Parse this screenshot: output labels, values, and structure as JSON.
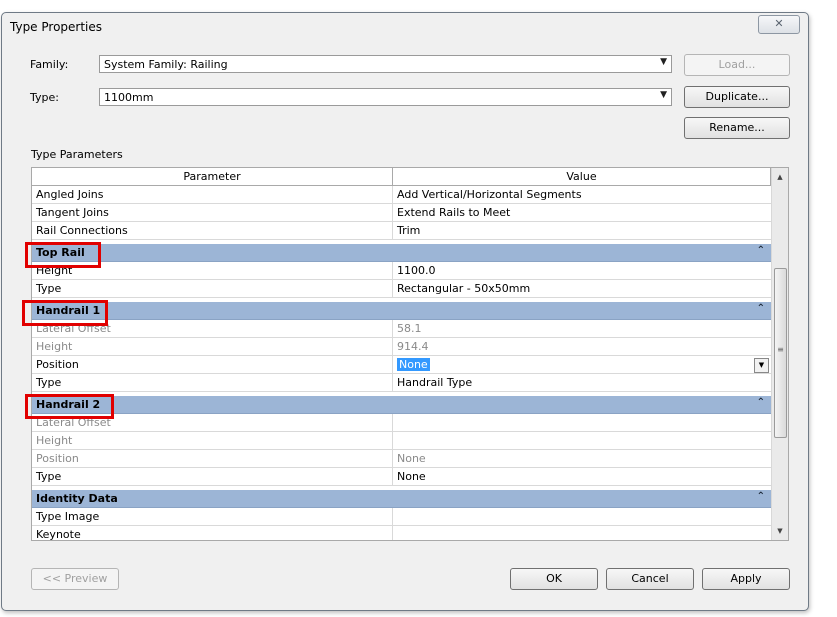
{
  "window": {
    "title": "Type Properties",
    "close_glyph": "✕"
  },
  "family": {
    "label": "Family:",
    "value": "System Family: Railing"
  },
  "type": {
    "label": "Type:",
    "value": "1100mm"
  },
  "buttons": {
    "load": "Load...",
    "duplicate": "Duplicate...",
    "rename": "Rename...",
    "preview": "<< Preview",
    "ok": "OK",
    "cancel": "Cancel",
    "apply": "Apply"
  },
  "type_parameters_label": "Type Parameters",
  "grid": {
    "headers": [
      "Parameter",
      "Value"
    ],
    "rows_top": [
      {
        "param": "Angled Joins",
        "value": "Add Vertical/Horizontal Segments"
      },
      {
        "param": "Tangent Joins",
        "value": "Extend Rails to Meet"
      },
      {
        "param": "Rail Connections",
        "value": "Trim"
      }
    ],
    "top_rail": {
      "label": "Top Rail",
      "rows": [
        {
          "param": "Height",
          "value": "1100.0"
        },
        {
          "param": "Type",
          "value": "Rectangular - 50x50mm"
        }
      ]
    },
    "handrail1": {
      "label": "Handrail 1",
      "rows": [
        {
          "param": "Lateral Offset",
          "value": "58.1"
        },
        {
          "param": "Height",
          "value": "914.4"
        },
        {
          "param": "Position",
          "value": "None"
        },
        {
          "param": "Type",
          "value": "Handrail Type"
        }
      ]
    },
    "handrail2": {
      "label": "Handrail 2",
      "rows": [
        {
          "param": "Lateral Offset",
          "value": ""
        },
        {
          "param": "Height",
          "value": ""
        },
        {
          "param": "Position",
          "value": "None"
        },
        {
          "param": "Type",
          "value": "None"
        }
      ]
    },
    "identity": {
      "label": "Identity Data",
      "rows": [
        {
          "param": "Type Image",
          "value": ""
        },
        {
          "param": "Keynote",
          "value": ""
        }
      ]
    },
    "collapse_glyph": "»"
  },
  "colors": {
    "group_header": "#9cb5d6",
    "selection": "#3399ff",
    "highlight_box": "#e10000"
  }
}
